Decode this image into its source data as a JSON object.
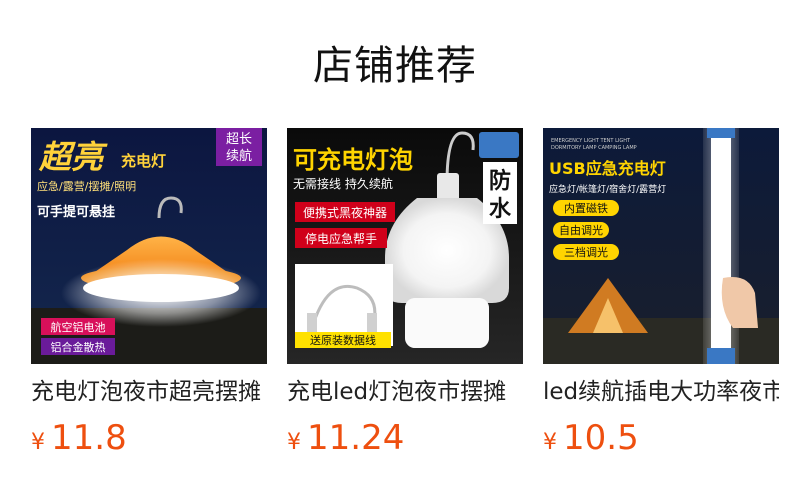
{
  "section": {
    "title": "店铺推荐"
  },
  "products": [
    {
      "name": "充电灯泡夜市超亮摆摊",
      "currency": "¥",
      "price": "11.8",
      "image": {
        "headline": "超亮",
        "subhead": "充电灯",
        "badge_line1": "超长",
        "badge_line2": "续航",
        "uses": "应急/露营/摆摊/照明",
        "hang_note": "可手提可悬挂",
        "tag1": "航空铝电池",
        "tag2": "铝合金散热"
      }
    },
    {
      "name": "充电led灯泡夜市摆摊",
      "currency": "¥",
      "price": "11.24",
      "image": {
        "headline": "可充电灯泡",
        "subhead": "无需接线 持久续航",
        "waterproof_1": "防",
        "waterproof_2": "水",
        "tag1": "便携式黑夜神器",
        "tag2": "停电应急帮手",
        "cable_note": "送原装数据线"
      }
    },
    {
      "name": "led续航插电大功率夜市",
      "currency": "¥",
      "price": "10.5",
      "image": {
        "tiny_line1": "EMERGENCY LIGHT TENT LIGHT",
        "tiny_line2": "DORMITORY LAMP CAMPING LAMP",
        "headline": "USB应急充电灯",
        "uses": "应急灯/帐篷灯/宿舍灯/露营灯",
        "tag1": "内置磁铁",
        "tag2": "自由调光",
        "tag3": "三档调光"
      }
    }
  ]
}
